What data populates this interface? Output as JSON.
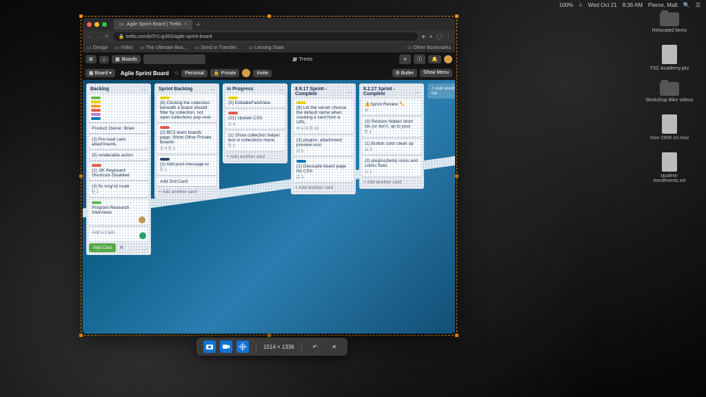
{
  "menubar": {
    "battery": "100%",
    "wifi_icon": "wifi",
    "day_date": "Wed Oct 21",
    "time": "8:36 AM",
    "user": "Pierce, Matt"
  },
  "desktop": {
    "items": [
      {
        "kind": "folder",
        "label": "Relocated Items"
      },
      {
        "kind": "doc",
        "label": "TSC Academy.pkz"
      },
      {
        "kind": "folder",
        "label": "Workshop Bike videos"
      },
      {
        "kind": "doc",
        "label": "mov-1508-10.mov"
      },
      {
        "kind": "doc",
        "label": "student-enrollments.xxt"
      }
    ]
  },
  "browser": {
    "tab_title": "Agile Sprint Board | Trello",
    "url": "trello.com/b/3YLig36S/agile-sprint-board",
    "bookmarks": [
      "Design",
      "Video",
      "The Ultimate Bea…",
      "Send or Transfer…",
      "Lansing State"
    ],
    "other_bookmarks": "Other Bookmarks"
  },
  "trello": {
    "logo": "Trello",
    "top_buttons": {
      "home": "⌂",
      "boards": "Boards"
    },
    "board_menu": "Board",
    "board_name": "Agile Sprint Board",
    "team": "Personal",
    "visibility": "Private",
    "invite": "Invite",
    "butler": "Butler",
    "show_menu": "Show Menu",
    "add_list": "+ Add another list",
    "add_card": "+ Add another card",
    "add_card_placeholder": "Add a Card",
    "add_card_button": "Add Card",
    "lists": [
      {
        "title": "Backlog",
        "header_labels": [
          "#61bd4f",
          "#f2d600",
          "#ff9f1a",
          "#eb5a46",
          "#c377e0",
          "#0079bf"
        ],
        "cards": [
          {
            "labels": [],
            "text": "Product Owner: Brian"
          },
          {
            "labels": [],
            "text": "(3) Pre-load card attachments"
          },
          {
            "labels": [],
            "text": "(5) renderable action"
          },
          {
            "labels": [
              "#eb5a46"
            ],
            "text": "(1) J/K Keyboard Shortcuts Disabled"
          },
          {
            "labels": [],
            "text": "(3) fix /org/:id route",
            "meta": "⎘ 1"
          },
          {
            "labels": [
              "#61bd4f"
            ],
            "text": "Program Research Interviews",
            "avatar": true
          }
        ],
        "composer": true
      },
      {
        "title": "Sprint Backlog",
        "cards": [
          {
            "labels": [
              "#f2d600"
            ],
            "text": "(8) Clicking the collection beneath a board should filter by collection, not open collections pop-over"
          },
          {
            "labels": [
              "#eb5a46"
            ],
            "text": "(2) BC3 team boards page: Show Other Private Boards",
            "meta": "☑ 4  ⎘ 1"
          },
          {
            "labels": [
              "#344563"
            ],
            "text": "(1) Add post-message-io",
            "meta": "⎘ 1"
          },
          {
            "labels": [],
            "text": "Add 2nd Card"
          }
        ]
      },
      {
        "title": "In Progress",
        "cards": [
          {
            "labels": [
              "#f2d600"
            ],
            "text": "(5) EditableFieldView"
          },
          {
            "labels": [
              "#eb5a46"
            ],
            "text": "(21) Update CSS",
            "meta": "☑ 4"
          },
          {
            "labels": [],
            "text": "(1) Show collection helper text in collections menu",
            "meta": "⎘ 1"
          }
        ]
      },
      {
        "title": "8.9.17 Sprint - Complete",
        "cards": [
          {
            "labels": [
              "#f2d600"
            ],
            "text": "(8) Let the server choose the default name when creating a card from a URL",
            "meta": "✉ ☑ 6  ⎘ 13"
          },
          {
            "labels": [],
            "text": "(3) plugins: attachment preview icon",
            "meta": "☑ 5"
          },
          {
            "labels": [
              "#0079bf"
            ],
            "text": "(1) Decouple board page list CSS",
            "meta": "☑ 3"
          }
        ]
      },
      {
        "title": "8.2.17 Sprint - Complete",
        "cards": [
          {
            "labels": [],
            "text": "⚠️Sprint Review ✏️",
            "meta": "✉"
          },
          {
            "labels": [],
            "text": "(3) Restore hidden short ids (or don't, up to you)",
            "meta": "⎘ 1"
          },
          {
            "labels": [],
            "text": "(1) Button color clean up",
            "meta": "☑ 3"
          },
          {
            "labels": [],
            "text": "(3) plugins(beta) icons and colors fixes",
            "meta": "☑ 1"
          }
        ]
      }
    ]
  },
  "capture_bar": {
    "dims": "1514 × 1336",
    "undo_icon": "undo",
    "close_icon": "close"
  }
}
